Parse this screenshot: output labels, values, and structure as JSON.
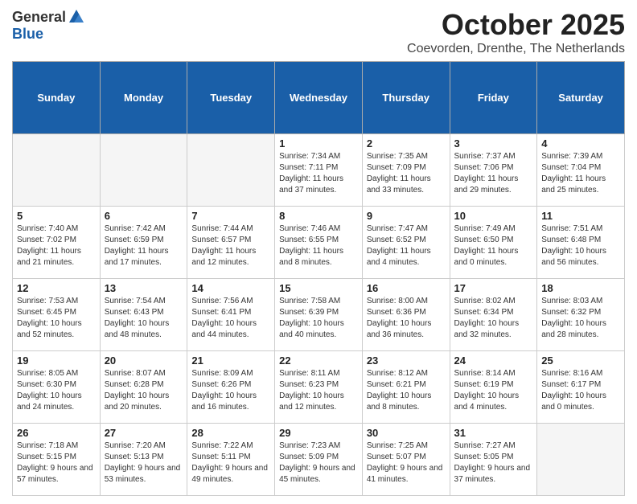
{
  "header": {
    "logo_general": "General",
    "logo_blue": "Blue",
    "title": "October 2025",
    "location": "Coevorden, Drenthe, The Netherlands"
  },
  "weekdays": [
    "Sunday",
    "Monday",
    "Tuesday",
    "Wednesday",
    "Thursday",
    "Friday",
    "Saturday"
  ],
  "weeks": [
    [
      {
        "day": "",
        "empty": true
      },
      {
        "day": "",
        "empty": true
      },
      {
        "day": "",
        "empty": true
      },
      {
        "day": "1",
        "sunrise": "7:34 AM",
        "sunset": "7:11 PM",
        "daylight": "11 hours and 37 minutes."
      },
      {
        "day": "2",
        "sunrise": "7:35 AM",
        "sunset": "7:09 PM",
        "daylight": "11 hours and 33 minutes."
      },
      {
        "day": "3",
        "sunrise": "7:37 AM",
        "sunset": "7:06 PM",
        "daylight": "11 hours and 29 minutes."
      },
      {
        "day": "4",
        "sunrise": "7:39 AM",
        "sunset": "7:04 PM",
        "daylight": "11 hours and 25 minutes."
      }
    ],
    [
      {
        "day": "5",
        "sunrise": "7:40 AM",
        "sunset": "7:02 PM",
        "daylight": "11 hours and 21 minutes."
      },
      {
        "day": "6",
        "sunrise": "7:42 AM",
        "sunset": "6:59 PM",
        "daylight": "11 hours and 17 minutes."
      },
      {
        "day": "7",
        "sunrise": "7:44 AM",
        "sunset": "6:57 PM",
        "daylight": "11 hours and 12 minutes."
      },
      {
        "day": "8",
        "sunrise": "7:46 AM",
        "sunset": "6:55 PM",
        "daylight": "11 hours and 8 minutes."
      },
      {
        "day": "9",
        "sunrise": "7:47 AM",
        "sunset": "6:52 PM",
        "daylight": "11 hours and 4 minutes."
      },
      {
        "day": "10",
        "sunrise": "7:49 AM",
        "sunset": "6:50 PM",
        "daylight": "11 hours and 0 minutes."
      },
      {
        "day": "11",
        "sunrise": "7:51 AM",
        "sunset": "6:48 PM",
        "daylight": "10 hours and 56 minutes."
      }
    ],
    [
      {
        "day": "12",
        "sunrise": "7:53 AM",
        "sunset": "6:45 PM",
        "daylight": "10 hours and 52 minutes."
      },
      {
        "day": "13",
        "sunrise": "7:54 AM",
        "sunset": "6:43 PM",
        "daylight": "10 hours and 48 minutes."
      },
      {
        "day": "14",
        "sunrise": "7:56 AM",
        "sunset": "6:41 PM",
        "daylight": "10 hours and 44 minutes."
      },
      {
        "day": "15",
        "sunrise": "7:58 AM",
        "sunset": "6:39 PM",
        "daylight": "10 hours and 40 minutes."
      },
      {
        "day": "16",
        "sunrise": "8:00 AM",
        "sunset": "6:36 PM",
        "daylight": "10 hours and 36 minutes."
      },
      {
        "day": "17",
        "sunrise": "8:02 AM",
        "sunset": "6:34 PM",
        "daylight": "10 hours and 32 minutes."
      },
      {
        "day": "18",
        "sunrise": "8:03 AM",
        "sunset": "6:32 PM",
        "daylight": "10 hours and 28 minutes."
      }
    ],
    [
      {
        "day": "19",
        "sunrise": "8:05 AM",
        "sunset": "6:30 PM",
        "daylight": "10 hours and 24 minutes."
      },
      {
        "day": "20",
        "sunrise": "8:07 AM",
        "sunset": "6:28 PM",
        "daylight": "10 hours and 20 minutes."
      },
      {
        "day": "21",
        "sunrise": "8:09 AM",
        "sunset": "6:26 PM",
        "daylight": "10 hours and 16 minutes."
      },
      {
        "day": "22",
        "sunrise": "8:11 AM",
        "sunset": "6:23 PM",
        "daylight": "10 hours and 12 minutes."
      },
      {
        "day": "23",
        "sunrise": "8:12 AM",
        "sunset": "6:21 PM",
        "daylight": "10 hours and 8 minutes."
      },
      {
        "day": "24",
        "sunrise": "8:14 AM",
        "sunset": "6:19 PM",
        "daylight": "10 hours and 4 minutes."
      },
      {
        "day": "25",
        "sunrise": "8:16 AM",
        "sunset": "6:17 PM",
        "daylight": "10 hours and 0 minutes."
      }
    ],
    [
      {
        "day": "26",
        "sunrise": "7:18 AM",
        "sunset": "5:15 PM",
        "daylight": "9 hours and 57 minutes."
      },
      {
        "day": "27",
        "sunrise": "7:20 AM",
        "sunset": "5:13 PM",
        "daylight": "9 hours and 53 minutes."
      },
      {
        "day": "28",
        "sunrise": "7:22 AM",
        "sunset": "5:11 PM",
        "daylight": "9 hours and 49 minutes."
      },
      {
        "day": "29",
        "sunrise": "7:23 AM",
        "sunset": "5:09 PM",
        "daylight": "9 hours and 45 minutes."
      },
      {
        "day": "30",
        "sunrise": "7:25 AM",
        "sunset": "5:07 PM",
        "daylight": "9 hours and 41 minutes."
      },
      {
        "day": "31",
        "sunrise": "7:27 AM",
        "sunset": "5:05 PM",
        "daylight": "9 hours and 37 minutes."
      },
      {
        "day": "",
        "empty": true
      }
    ]
  ]
}
